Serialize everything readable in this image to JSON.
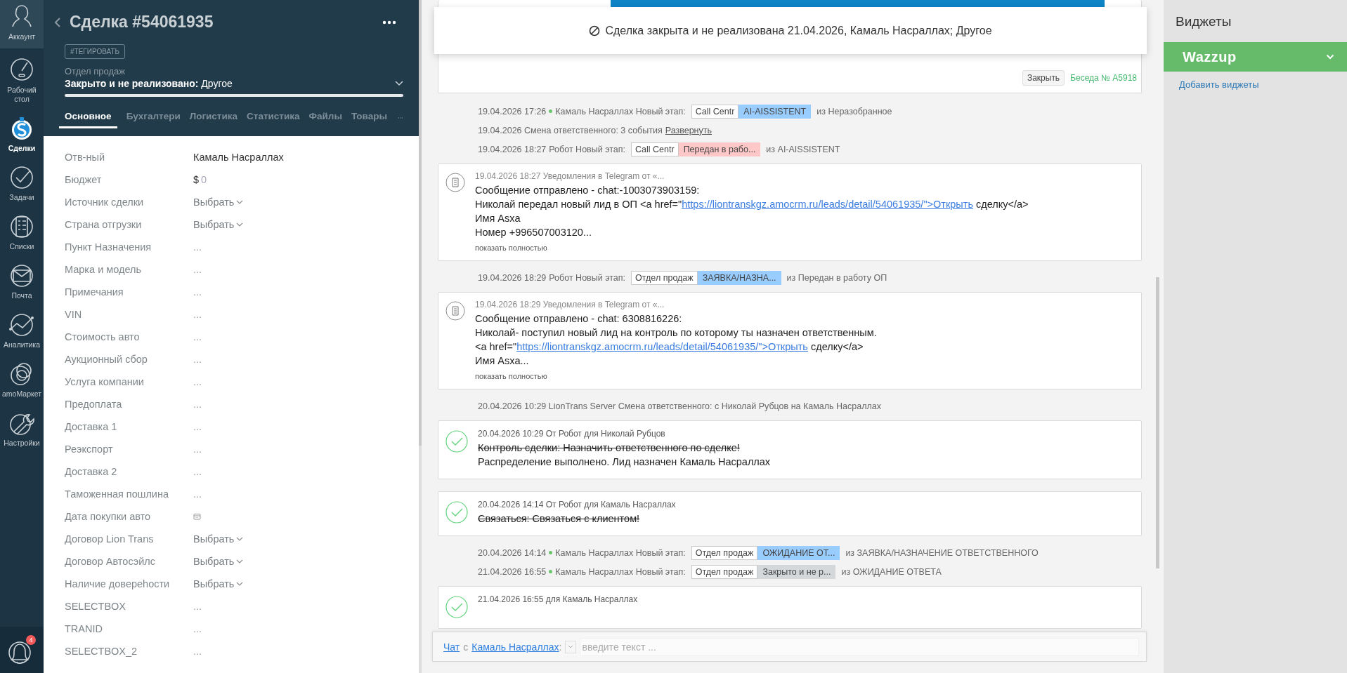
{
  "nav": {
    "items": [
      {
        "label": "Аккаунт",
        "selected": false
      },
      {
        "label": "Рабочий стол",
        "selected": false
      },
      {
        "label": "Сделки",
        "selected": true
      },
      {
        "label": "Задачи",
        "selected": false
      },
      {
        "label": "Списки",
        "selected": false
      },
      {
        "label": "Почта",
        "selected": false
      },
      {
        "label": "Аналитика",
        "selected": false
      },
      {
        "label": "amoМаркет",
        "selected": false
      },
      {
        "label": "Настройки",
        "selected": false
      }
    ],
    "notifications": "4"
  },
  "deal": {
    "title": "Сделка #54061935",
    "tag_button": "#ТЕГИРОВАТЬ",
    "pipeline": "Отдел продаж",
    "status": "**Закрыто и не реализовано:** Другое",
    "tabs": [
      {
        "label": "Основное",
        "selected": true
      },
      {
        "label": "Бухгалтери",
        "selected": false
      },
      {
        "label": "Логистика",
        "selected": false
      },
      {
        "label": "Статистика",
        "selected": false
      },
      {
        "label": "Файлы",
        "selected": false
      },
      {
        "label": "Товары",
        "selected": false
      }
    ],
    "fields": [
      {
        "label": "Отв-ный",
        "kind": "text",
        "value": "Камаль Насраллах"
      },
      {
        "label": "Бюджет",
        "kind": "money",
        "currency": "$",
        "value": "0"
      },
      {
        "label": "Источник сделки",
        "kind": "select",
        "value": "Выбрать"
      },
      {
        "label": "Страна отгрузки",
        "kind": "select",
        "value": "Выбрать"
      },
      {
        "label": "Пункт Назначения",
        "kind": "empty",
        "value": "..."
      },
      {
        "label": "Марка и модель",
        "kind": "empty",
        "value": "..."
      },
      {
        "label": "Примечания",
        "kind": "empty",
        "value": "..."
      },
      {
        "label": "VIN",
        "kind": "empty",
        "value": "..."
      },
      {
        "label": "Стоимость авто",
        "kind": "empty",
        "value": "..."
      },
      {
        "label": "Аукционный сбор",
        "kind": "empty",
        "value": "..."
      },
      {
        "label": "Услуга компании",
        "kind": "empty",
        "value": "..."
      },
      {
        "label": "Предоплата",
        "kind": "empty",
        "value": "..."
      },
      {
        "label": "Доставка 1",
        "kind": "empty",
        "value": "..."
      },
      {
        "label": "Реэкспорт",
        "kind": "empty",
        "value": "..."
      },
      {
        "label": "Доставка 2",
        "kind": "empty",
        "value": "..."
      },
      {
        "label": "Таможенная пошлина",
        "kind": "empty",
        "value": "..."
      },
      {
        "label": "Дата покупки авто",
        "kind": "date"
      },
      {
        "label": "Договор Lion Trans",
        "kind": "select",
        "value": "Выбрать"
      },
      {
        "label": "Договор Автосэйлс",
        "kind": "select",
        "value": "Выбрать"
      },
      {
        "label": "Наличие довереhости",
        "kind": "select",
        "value": "Выбрать"
      },
      {
        "label": "SELECTBOX",
        "kind": "empty",
        "value": "..."
      },
      {
        "label": "TRANID",
        "kind": "empty",
        "value": "..."
      },
      {
        "label": "SELECTBOX_2",
        "kind": "empty",
        "value": "..."
      }
    ]
  },
  "feed": {
    "closed_notice": "Сделка закрыта и не реализована 21.04.2026, Камаль Насраллах; Другое",
    "close_button": "Закрыть",
    "conversation": "Беседа № A5918",
    "events": [
      {
        "kind": "stage",
        "time": "19.04.2026 17:26",
        "online": true,
        "author": "Камаль Насраллах Новый этап:",
        "pipeline": "Call Centr",
        "stage": "AI-AISSISTENT",
        "color": "#99ccff",
        "from": "из Неразобранное"
      },
      {
        "kind": "line",
        "text": "19.04.2026 Смена ответственного: 3 события",
        "link": "Развернуть"
      },
      {
        "kind": "stage",
        "time": "19.04.2026 18:27",
        "online": false,
        "author": "Робот Новый этап:",
        "pipeline": "Call Centr",
        "stage": "Передан в рабо...",
        "color": "#ffc8c8",
        "from": "из AI-AISSISTENT"
      },
      {
        "kind": "note",
        "header": "19.04.2026 18:27 Уведомления в Telegram от «...",
        "lines": [
          [
            {
              "text": "Сообщение отправлено - chat:-1003073903159:"
            }
          ],
          [
            {
              "text": "Николай передал новый лид в ОП <a href=\""
            },
            {
              "text": "https://liontranskgz.amocrm.ru/leads/detail/54061935/\">Открыть",
              "link": true
            },
            {
              "text": " сделку</a>"
            }
          ],
          [
            {
              "text": "Имя Asxa"
            }
          ],
          [
            {
              "text": "Номер +996507003120..."
            }
          ]
        ],
        "more": "показать полностью"
      },
      {
        "kind": "stage",
        "time": "19.04.2026 18:29",
        "online": false,
        "author": "Робот Новый этап:",
        "pipeline": "Отдел продаж",
        "stage": "ЗАЯВКА/НАЗНА...",
        "color": "#99ccff",
        "from": "из Передан в работу ОП"
      },
      {
        "kind": "note",
        "header": "19.04.2026 18:29 Уведомления в Telegram от «...",
        "lines": [
          [
            {
              "text": "Сообщение отправлено - chat: 6308816226:"
            }
          ],
          [
            {
              "text": "Николай- поступил новый лид на контроль по которому ты назначен ответственным."
            }
          ],
          [
            {
              "text": "<a href=\""
            },
            {
              "text": "https://liontranskgz.amocrm.ru/leads/detail/54061935/\">Открыть",
              "link": true
            },
            {
              "text": " сделку</a>"
            }
          ],
          [
            {
              "text": "Имя Asxa..."
            }
          ]
        ],
        "more": "показать полностью"
      },
      {
        "kind": "line",
        "text": "20.04.2026 10:29 LionTrans Server Смена ответственного: с Николай Рубцов на Камаль Насраллах"
      },
      {
        "kind": "task",
        "header": "20.04.2026 10:29  От Робот для Николай Рубцов",
        "done": true,
        "title": "Контроль сделки: Назначить ответственного по сделке!",
        "result": "Распределение выполнено. Лид назначен Камаль Насраллах"
      },
      {
        "kind": "task",
        "header": "20.04.2026 14:14  От Робот для Камаль Насраллах",
        "done": true,
        "title": "Связаться: Связаться с клиентом!"
      },
      {
        "kind": "stage",
        "time": "20.04.2026 14:14",
        "online": true,
        "author": "Камаль Насраллах Новый этап:",
        "pipeline": "Отдел продаж",
        "stage": "ОЖИДАНИЕ ОТ...",
        "color": "#99ccff",
        "from": "из ЗАЯВКА/НАЗНАЧЕНИЕ ОТВЕТСТВЕННОГО"
      },
      {
        "kind": "stage",
        "time": "21.04.2026 16:55",
        "online": true,
        "author": "Камаль Насраллах Новый этап:",
        "pipeline": "Отдел продаж",
        "stage": "Закрыто и не р...",
        "color": "#d5d8db",
        "from": "из ОЖИДАНИЕ ОТВЕТА"
      },
      {
        "kind": "task",
        "header": "21.04.2026 16:55  для Камаль Насраллах"
      }
    ],
    "chat": {
      "link": "Чат",
      "preposition": "с",
      "recipient": "Камаль Насраллах",
      "separator": ":",
      "placeholder": "введите текст ..."
    }
  },
  "widgets": {
    "title": "Виджеты",
    "items": [
      {
        "name": "Wazzup"
      }
    ],
    "add_link": "Добавить виджеты"
  }
}
